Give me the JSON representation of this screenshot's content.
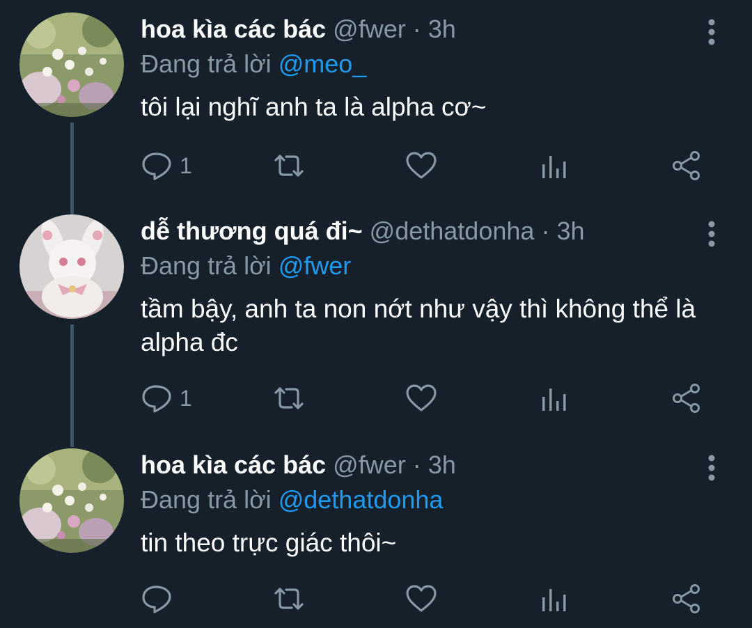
{
  "tweets": [
    {
      "name": "hoa kìa các bác",
      "handle": "@fwer",
      "separator": "·",
      "time": "3h",
      "replying_prefix": "Đang trả lời",
      "replying_to": "@meo_",
      "text": "tôi lại nghĩ anh ta là alpha cơ~",
      "reply_count": "1",
      "avatar": "flowers-photo"
    },
    {
      "name": "dễ thương quá đi~",
      "handle": "@dethatdonha",
      "separator": "·",
      "time": "3h",
      "replying_prefix": "Đang trả lời",
      "replying_to": "@fwer",
      "text": "tầm bậy, anh ta non nớt như vậy thì không thể là alpha đc",
      "reply_count": "1",
      "avatar": "plush-bunny-photo"
    },
    {
      "name": "hoa kìa các bác",
      "handle": "@fwer",
      "separator": "·",
      "time": "3h",
      "replying_prefix": "Đang trả lời",
      "replying_to": "@dethatdonha",
      "text": "tin theo trực giác thôi~",
      "reply_count": "",
      "avatar": "flowers-photo"
    }
  ],
  "colors": {
    "background": "#15202b",
    "text_primary": "#ffffff",
    "text_secondary": "#8899a6",
    "link": "#1d9bf0",
    "thread_line": "#3d5466"
  },
  "icons": [
    "reply-icon",
    "retweet-icon",
    "like-icon",
    "analytics-icon",
    "share-icon",
    "more-options-icon"
  ]
}
